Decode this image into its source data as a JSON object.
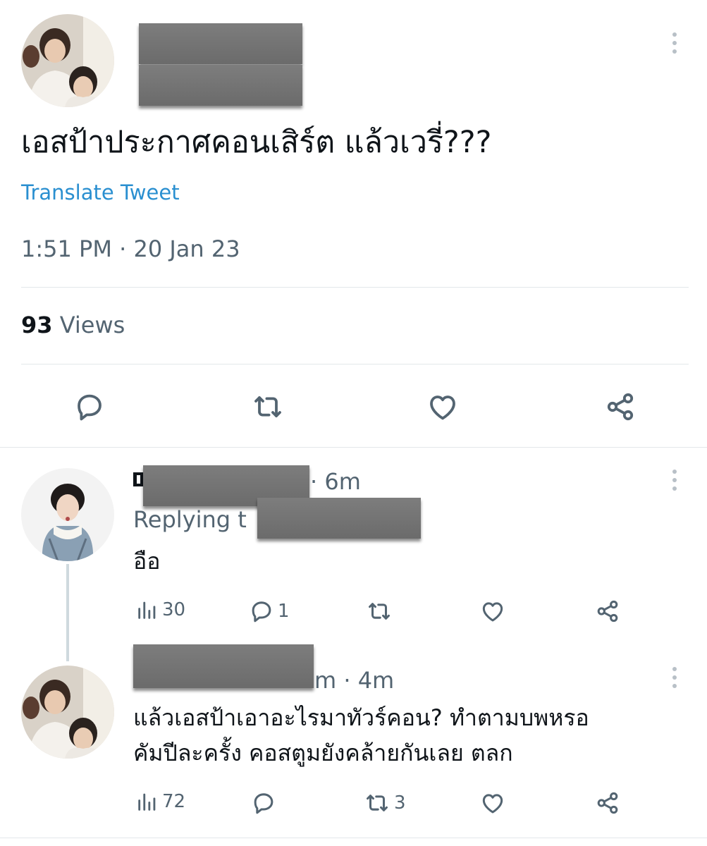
{
  "main_tweet": {
    "text": "เอสป้าประกาศคอนเสิร์ต แล้วเวรี่???",
    "translate_label": "Translate Tweet",
    "timestamp": "1:51 PM · 20 Jan 23",
    "views_count": "93",
    "views_label": "Views"
  },
  "replies": [
    {
      "time": "· 6m",
      "replying_to_label": "Replying t",
      "text": "อือ",
      "views": "30",
      "replies": "1",
      "retweets": "",
      "likes": ""
    },
    {
      "time": "m · 4m",
      "text_line1": "แล้วเอสป้าเอาอะไรมาทัวร์คอน? ทำตามบพหรอ",
      "text_line2": "คัมปีละครั้ง คอสตูมยังคล้ายกันเลย ตลก",
      "views": "72",
      "replies": "",
      "retweets": "3",
      "likes": ""
    }
  ],
  "colors": {
    "text_primary": "#0f1419",
    "text_secondary": "#536471",
    "link": "#2a8fd0",
    "divider": "#e3e7ea"
  },
  "icons": [
    "more-icon",
    "reply-icon",
    "retweet-icon",
    "like-icon",
    "share-icon",
    "views-icon"
  ]
}
